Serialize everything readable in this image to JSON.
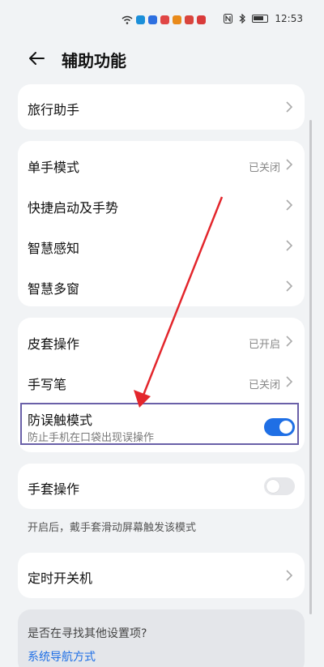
{
  "status_bar": {
    "time": "12:53",
    "app_icons": [
      "#1b8fd9",
      "#2d6fe0",
      "#e04545",
      "#e98a1a",
      "#d9443c",
      "#d93a3a"
    ],
    "icons": [
      "wifi-icon",
      "nfc-icon",
      "bluetooth-icon",
      "battery-icon"
    ]
  },
  "header": {
    "title": "辅助功能"
  },
  "groups": {
    "travel": {
      "label": "旅行助手"
    },
    "one_hand": {
      "label": "单手模式",
      "value": "已关闭"
    },
    "quick_launch": {
      "label": "快捷启动及手势"
    },
    "smart_sense": {
      "label": "智慧感知"
    },
    "multi_window": {
      "label": "智慧多窗"
    },
    "cover": {
      "label": "皮套操作",
      "value": "已开启"
    },
    "stylus": {
      "label": "手写笔",
      "value": "已关闭"
    },
    "mistouch": {
      "label": "防误触模式",
      "sublabel": "防止手机在口袋出现误操作",
      "toggle": "on"
    },
    "glove": {
      "label": "手套操作",
      "toggle": "off"
    },
    "glove_note": "开启后，戴手套滑动屏幕触发该模式",
    "schedule_power": {
      "label": "定时开关机"
    },
    "more": {
      "question": "是否在寻找其他设置项?",
      "link": "系统导航方式"
    }
  },
  "colors": {
    "accent": "#1f6fe5",
    "annotation_arrow": "#e3262c",
    "highlight_box": "#6a60a8"
  }
}
